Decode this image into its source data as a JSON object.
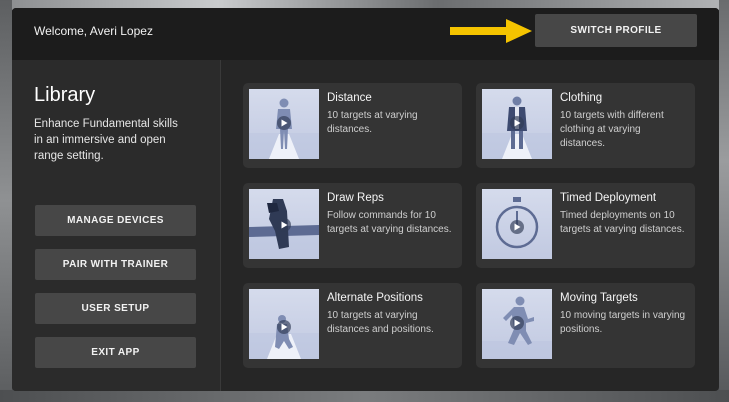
{
  "header": {
    "welcome_text": "Welcome, Averi Lopez",
    "switch_profile_label": "SWITCH PROFILE",
    "arrow_color": "#f5c400"
  },
  "sidebar": {
    "title": "Library",
    "description": "Enhance Fundamental skills in an immersive and open range setting.",
    "buttons": [
      {
        "label": "MANAGE DEVICES"
      },
      {
        "label": "PAIR WITH TRAINER"
      },
      {
        "label": "USER SETUP"
      },
      {
        "label": "EXIT APP"
      }
    ]
  },
  "library": {
    "cards": [
      {
        "title": "Distance",
        "description": "10 targets at varying distances.",
        "icon": "standing-target-icon"
      },
      {
        "title": "Clothing",
        "description": "10 targets with different clothing at varying distances.",
        "icon": "clothed-target-icon"
      },
      {
        "title": "Draw Reps",
        "description": "Follow commands for 10 targets at varying distances.",
        "icon": "holster-icon"
      },
      {
        "title": "Timed Deployment",
        "description": "Timed deployments on 10 targets at varying distances.",
        "icon": "stopwatch-icon"
      },
      {
        "title": "Alternate Positions",
        "description": "10 targets at varying distances and positions.",
        "icon": "kneeling-target-icon"
      },
      {
        "title": "Moving Targets",
        "description": "10 moving targets in varying positions.",
        "icon": "running-target-icon"
      }
    ]
  },
  "colors": {
    "panel_bg": "#262626",
    "button_bg": "#474747",
    "card_bg": "#343434",
    "thumb_bg": "#c8d0e6"
  }
}
